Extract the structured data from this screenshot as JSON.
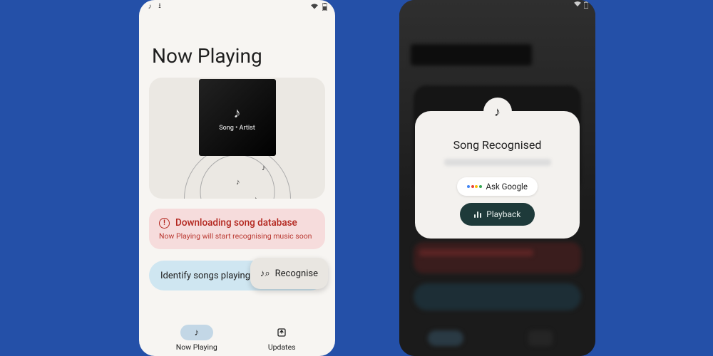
{
  "left": {
    "title": "Now Playing",
    "album_caption": "Song • Artist",
    "alert": {
      "title": "Downloading song database",
      "subtitle": "Now Playing will start recognising music soon"
    },
    "identify_label": "Identify songs playing n",
    "recognise_label": "Recognise",
    "nav": {
      "now_playing": "Now Playing",
      "updates": "Updates"
    }
  },
  "right": {
    "modal_title": "Song Recognised",
    "ask_label": "Ask Google",
    "playback_label": "Playback"
  }
}
